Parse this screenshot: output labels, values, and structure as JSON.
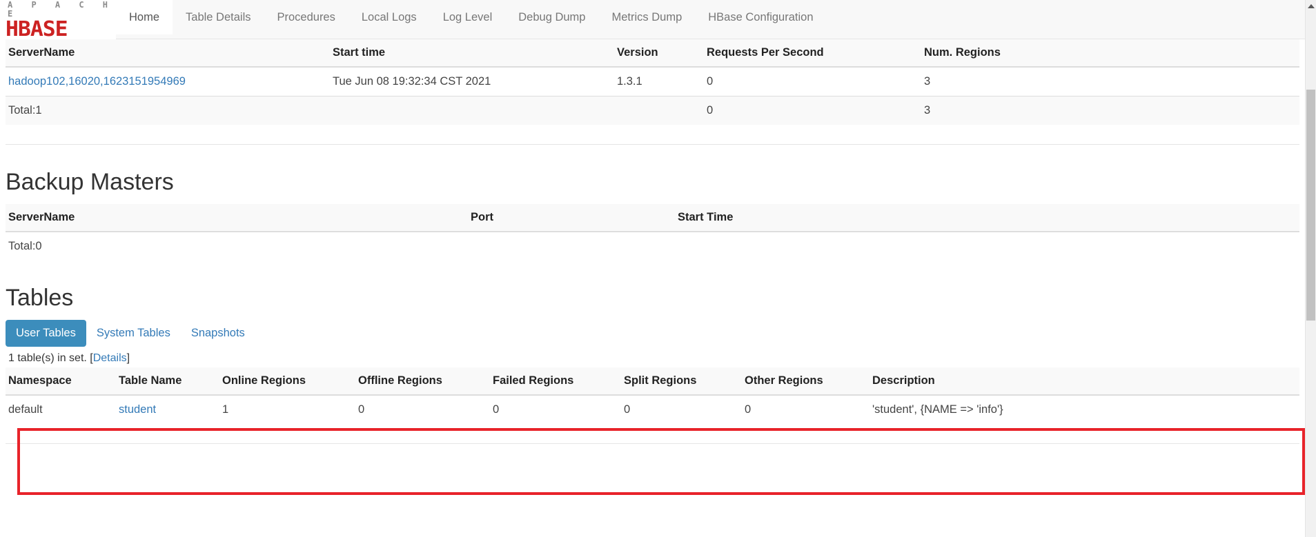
{
  "brand": {
    "apache": "A P A C H E",
    "hbase": "HBASE"
  },
  "nav": {
    "items": [
      {
        "label": "Home",
        "active": true
      },
      {
        "label": "Table Details",
        "active": false
      },
      {
        "label": "Procedures",
        "active": false
      },
      {
        "label": "Local Logs",
        "active": false
      },
      {
        "label": "Log Level",
        "active": false
      },
      {
        "label": "Debug Dump",
        "active": false
      },
      {
        "label": "Metrics Dump",
        "active": false
      },
      {
        "label": "HBase Configuration",
        "active": false
      }
    ]
  },
  "region_servers": {
    "columns": {
      "server_name": "ServerName",
      "start_time": "Start time",
      "version": "Version",
      "requests_per_second": "Requests Per Second",
      "num_regions": "Num. Regions"
    },
    "rows": [
      {
        "server_name": "hadoop102,16020,1623151954969",
        "start_time": "Tue Jun 08 19:32:34 CST 2021",
        "version": "1.3.1",
        "requests_per_second": "0",
        "num_regions": "3"
      }
    ],
    "total": {
      "label": "Total:1",
      "requests_per_second": "0",
      "num_regions": "3"
    }
  },
  "backup_masters": {
    "title": "Backup Masters",
    "columns": {
      "server_name": "ServerName",
      "port": "Port",
      "start_time": "Start Time"
    },
    "total": {
      "label": "Total:0"
    }
  },
  "tables": {
    "title": "Tables",
    "tabs": [
      {
        "label": "User Tables",
        "active": true
      },
      {
        "label": "System Tables",
        "active": false
      },
      {
        "label": "Snapshots",
        "active": false
      }
    ],
    "set_info_prefix": "1 table(s) in set. [",
    "set_info_link": "Details",
    "set_info_suffix": "]",
    "columns": {
      "namespace": "Namespace",
      "table_name": "Table Name",
      "online_regions": "Online Regions",
      "offline_regions": "Offline Regions",
      "failed_regions": "Failed Regions",
      "split_regions": "Split Regions",
      "other_regions": "Other Regions",
      "description": "Description"
    },
    "rows": [
      {
        "namespace": "default",
        "table_name": "student",
        "online_regions": "1",
        "offline_regions": "0",
        "failed_regions": "0",
        "split_regions": "0",
        "other_regions": "0",
        "description": "'student', {NAME => 'info'}"
      }
    ]
  },
  "annotation": {
    "highlight_color": "#e8232a"
  },
  "scrollbar": {
    "up_arrow": "scroll-up-arrow"
  }
}
